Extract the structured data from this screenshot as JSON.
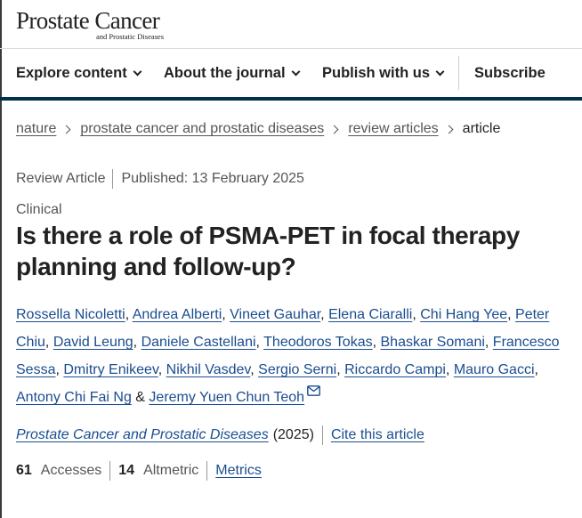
{
  "logo": {
    "main": "Prostate Cancer",
    "sub": "and Prostatic Diseases"
  },
  "nav": {
    "items": [
      {
        "label": "Explore content"
      },
      {
        "label": "About the journal"
      },
      {
        "label": "Publish with us"
      }
    ],
    "subscribe": "Subscribe"
  },
  "colors": {
    "nav_rule": "#01324b",
    "link": "#1a4d8f",
    "muted": "#555555"
  },
  "breadcrumb": {
    "items": [
      "nature",
      "prostate cancer and prostatic diseases",
      "review articles"
    ],
    "current": "article"
  },
  "meta": {
    "type": "Review Article",
    "published": "Published: 13 February 2025"
  },
  "subject": "Clinical",
  "title": "Is there a role of PSMA-PET in focal therapy planning and follow-up?",
  "authors": [
    "Rossella Nicoletti",
    "Andrea Alberti",
    "Vineet Gauhar",
    "Elena Ciaralli",
    "Chi Hang Yee",
    "Peter Chiu",
    "David Leung",
    "Daniele Castellani",
    "Theodoros Tokas",
    "Bhaskar Somani",
    "Francesco Sessa",
    "Dmitry Enikeev",
    "Nikhil Vasdev",
    "Sergio Serni",
    "Riccardo Campi",
    "Mauro Gacci",
    "Antony Chi Fai Ng",
    "Jeremy Yuen Chun Teoh"
  ],
  "authors_separators": {
    "comma": ",",
    "and": "&"
  },
  "journal": {
    "name": "Prostate Cancer and Prostatic Diseases",
    "year": "(2025)",
    "cite": "Cite this article"
  },
  "metrics": {
    "accesses_value": "61",
    "accesses_label": "Accesses",
    "altmetric_value": "14",
    "altmetric_label": "Altmetric",
    "link": "Metrics"
  },
  "icons": {
    "mail": "mail-icon",
    "chevron": "chevron-down-icon",
    "crumb": "chevron-right-icon"
  }
}
